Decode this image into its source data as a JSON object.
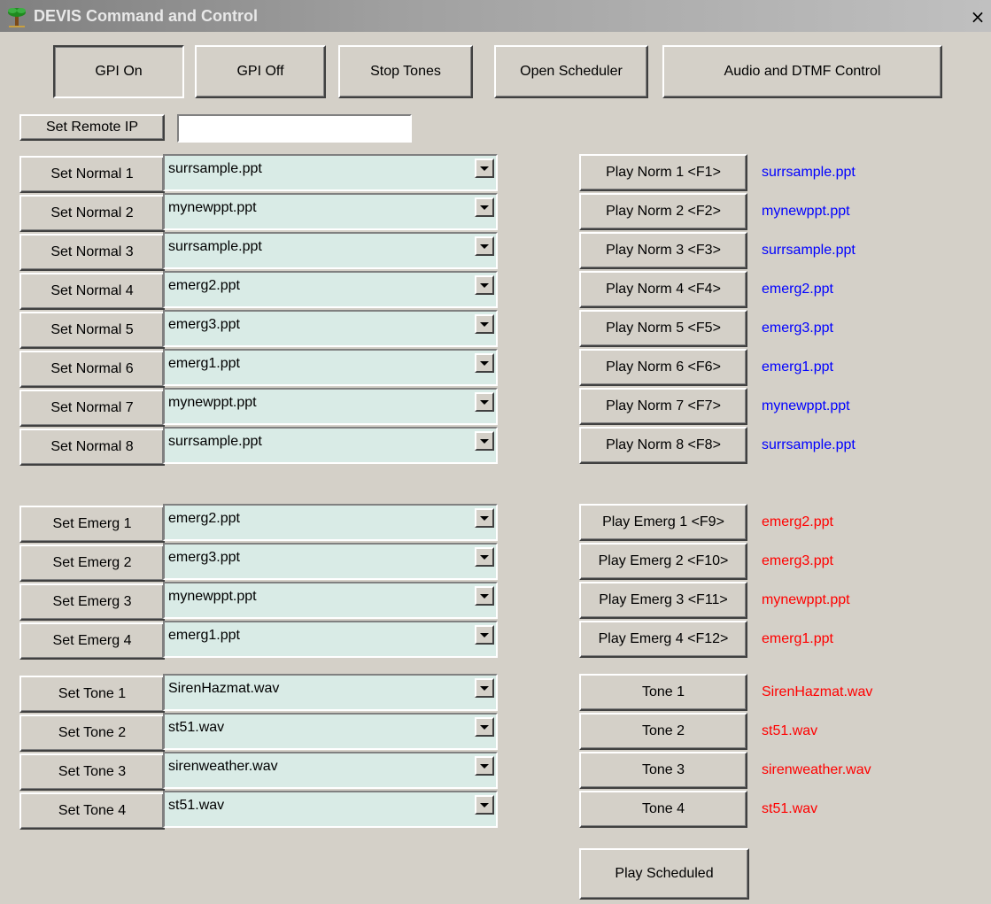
{
  "window": {
    "title": "DEVIS Command and Control",
    "close_glyph": "×"
  },
  "toolbar": {
    "gpi_on": "GPI On",
    "gpi_off": "GPI Off",
    "stop_tones": "Stop Tones",
    "open_scheduler": "Open Scheduler",
    "audio_dtmf": "Audio and DTMF Control"
  },
  "remote": {
    "button": "Set Remote IP",
    "value": ""
  },
  "normal": [
    {
      "set": "Set Normal 1",
      "file": "surrsample.ppt",
      "play": "Play Norm 1 <F1>",
      "status": "surrsample.ppt"
    },
    {
      "set": "Set Normal 2",
      "file": "mynewppt.ppt",
      "play": "Play Norm 2 <F2>",
      "status": "mynewppt.ppt"
    },
    {
      "set": "Set Normal 3",
      "file": "surrsample.ppt",
      "play": "Play Norm 3 <F3>",
      "status": "surrsample.ppt"
    },
    {
      "set": "Set Normal 4",
      "file": "emerg2.ppt",
      "play": "Play Norm 4 <F4>",
      "status": "emerg2.ppt"
    },
    {
      "set": "Set Normal 5",
      "file": "emerg3.ppt",
      "play": "Play Norm 5 <F5>",
      "status": "emerg3.ppt"
    },
    {
      "set": "Set Normal 6",
      "file": "emerg1.ppt",
      "play": "Play Norm 6 <F6>",
      "status": "emerg1.ppt"
    },
    {
      "set": "Set Normal 7",
      "file": "mynewppt.ppt",
      "play": "Play Norm 7 <F7>",
      "status": "mynewppt.ppt"
    },
    {
      "set": "Set Normal 8",
      "file": "surrsample.ppt",
      "play": "Play Norm 8 <F8>",
      "status": "surrsample.ppt"
    }
  ],
  "emerg": [
    {
      "set": "Set Emerg 1",
      "file": "emerg2.ppt",
      "play": "Play Emerg 1 <F9>",
      "status": "emerg2.ppt"
    },
    {
      "set": "Set Emerg 2",
      "file": "emerg3.ppt",
      "play": "Play Emerg 2 <F10>",
      "status": "emerg3.ppt"
    },
    {
      "set": "Set Emerg 3",
      "file": "mynewppt.ppt",
      "play": "Play Emerg 3 <F11>",
      "status": "mynewppt.ppt"
    },
    {
      "set": "Set Emerg 4",
      "file": "emerg1.ppt",
      "play": "Play Emerg 4 <F12>",
      "status": "emerg1.ppt"
    }
  ],
  "tones": [
    {
      "set": "Set Tone 1",
      "file": "SirenHazmat.wav",
      "play": "Tone 1",
      "status": "SirenHazmat.wav"
    },
    {
      "set": "Set Tone 2",
      "file": "st51.wav",
      "play": "Tone 2",
      "status": "st51.wav"
    },
    {
      "set": "Set Tone 3",
      "file": "sirenweather.wav",
      "play": "Tone 3",
      "status": "sirenweather.wav"
    },
    {
      "set": "Set Tone 4",
      "file": "st51.wav",
      "play": "Tone 4",
      "status": "st51.wav"
    }
  ],
  "play_scheduled": "Play Scheduled",
  "colors": {
    "normal_status": "#0000ff",
    "alert_status": "#ff0000",
    "combo_bg": "#d9ebe6",
    "face": "#d4d0c8"
  },
  "icons": {
    "app": "palm-tree-icon",
    "close": "close-icon",
    "dropdown": "dropdown-arrow-icon"
  }
}
